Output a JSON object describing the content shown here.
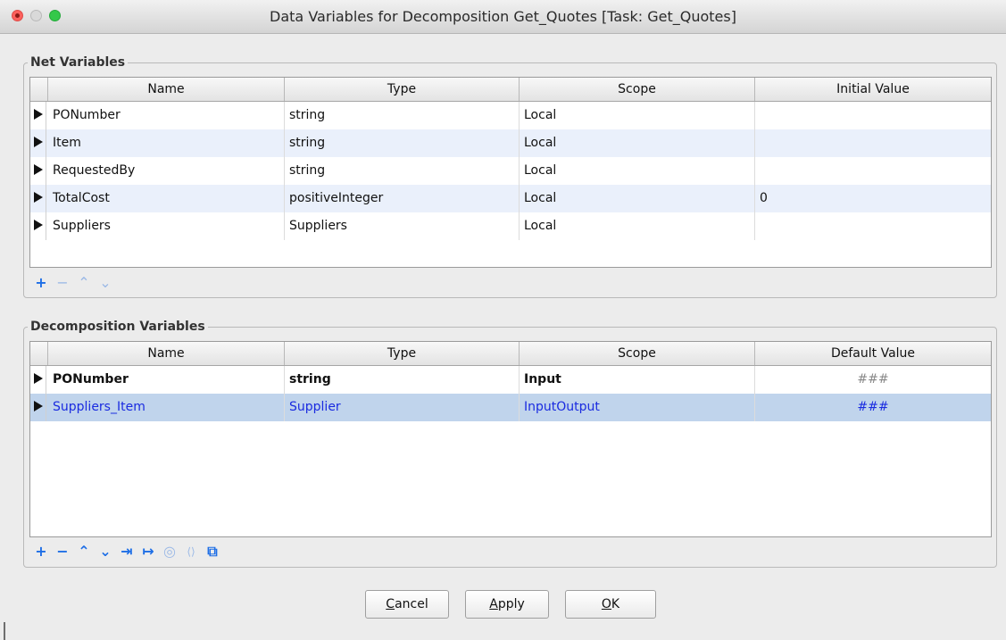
{
  "window": {
    "title": "Data Variables for Decomposition Get_Quotes [Task: Get_Quotes]"
  },
  "net": {
    "label": "Net Variables",
    "columns": [
      "Name",
      "Type",
      "Scope",
      "Initial Value"
    ],
    "rows": [
      {
        "name": "PONumber",
        "type": "string",
        "scope": "Local",
        "value": ""
      },
      {
        "name": "Item",
        "type": "string",
        "scope": "Local",
        "value": ""
      },
      {
        "name": "RequestedBy",
        "type": "string",
        "scope": "Local",
        "value": ""
      },
      {
        "name": "TotalCost",
        "type": "positiveInteger",
        "scope": "Local",
        "value": "0"
      },
      {
        "name": "Suppliers",
        "type": "Suppliers",
        "scope": "Local",
        "value": ""
      }
    ],
    "toolbar": [
      {
        "icon": "add-icon",
        "glyph": "+"
      },
      {
        "icon": "remove-icon",
        "glyph": "−"
      },
      {
        "icon": "move-up-icon",
        "glyph": "⌃"
      },
      {
        "icon": "move-down-icon",
        "glyph": "⌄"
      }
    ]
  },
  "decomp": {
    "label": "Decomposition Variables",
    "columns": [
      "Name",
      "Type",
      "Scope",
      "Default Value"
    ],
    "rows": [
      {
        "name": "PONumber",
        "type": "string",
        "scope": "Input",
        "value": "###"
      },
      {
        "name": "Suppliers_Item",
        "type": "Supplier",
        "scope": "InputOutput",
        "value": "###"
      }
    ],
    "toolbar": [
      {
        "icon": "add-icon",
        "glyph": "+"
      },
      {
        "icon": "remove-icon",
        "glyph": "−"
      },
      {
        "icon": "move-up-icon",
        "glyph": "⌃"
      },
      {
        "icon": "move-down-icon",
        "glyph": "⌄"
      },
      {
        "icon": "map-to-net-icon",
        "glyph": "⇥"
      },
      {
        "icon": "map-from-net-icon",
        "glyph": "↦"
      },
      {
        "icon": "target-icon",
        "glyph": "◎"
      },
      {
        "icon": "mapping-icon",
        "glyph": "⟨⟩"
      },
      {
        "icon": "copy-icon",
        "glyph": "⧉"
      }
    ]
  },
  "buttons": {
    "cancel_mnemonic": "C",
    "cancel_rest": "ancel",
    "apply_mnemonic": "A",
    "apply_rest": "pply",
    "ok_mnemonic": "O",
    "ok_rest": "K"
  },
  "colors": {
    "alt_row": "#eaf0fb",
    "selected_row": "#c0d4ec",
    "selected_text": "#1a2be0",
    "toolbar_icon": "#1d6ee6"
  }
}
